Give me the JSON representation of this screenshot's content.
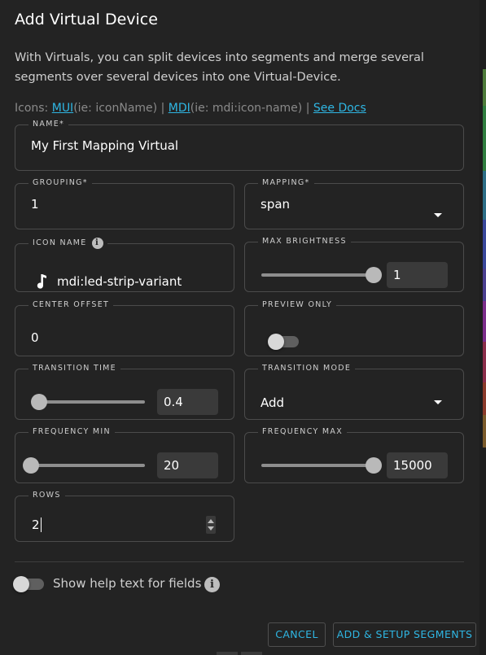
{
  "dialog": {
    "title": "Add Virtual Device",
    "description": "With Virtuals, you can split devices into segments and merge several segments over several devices into one Virtual-Device."
  },
  "icons_hint": {
    "prefix": "Icons: ",
    "mui_link": "MUI",
    "mui_hint": "(ie: iconName) | ",
    "mdi_link": "MDI",
    "mdi_hint": "(ie: mdi:icon-name) | ",
    "docs_link": "See Docs"
  },
  "fields": {
    "name": {
      "label": "NAME*",
      "value": "My First Mapping Virtual"
    },
    "grouping": {
      "label": "GROUPING*",
      "value": "1"
    },
    "mapping": {
      "label": "MAPPING*",
      "value": "span"
    },
    "icon_name": {
      "label": "ICON NAME",
      "value": "mdi:led-strip-variant",
      "icon": "music-note-icon"
    },
    "max_brightness": {
      "label": "MAX BRIGHTNESS",
      "value": "1",
      "level": 1.0
    },
    "center_offset": {
      "label": "CENTER OFFSET",
      "value": "0"
    },
    "preview_only": {
      "label": "PREVIEW ONLY",
      "on": false
    },
    "transition_time": {
      "label": "TRANSITION TIME",
      "value": "0.4",
      "level": 0.0
    },
    "transition_mode": {
      "label": "TRANSITION MODE",
      "value": "Add"
    },
    "frequency_min": {
      "label": "FREQUENCY MIN",
      "value": "20",
      "level": 0.0
    },
    "frequency_max": {
      "label": "FREQUENCY MAX",
      "value": "15000",
      "level": 1.0
    },
    "rows": {
      "label": "ROWS",
      "value": "2"
    }
  },
  "help_toggle": {
    "label": "Show help text for fields",
    "on": false
  },
  "buttons": {
    "cancel": "CANCEL",
    "add_setup": "ADD & SETUP SEGMENTS"
  },
  "colors": {
    "background": "#232323",
    "accent": "#2fb6e3",
    "border": "#4b4b4b",
    "slider_thumb": "#b9b9b9"
  }
}
